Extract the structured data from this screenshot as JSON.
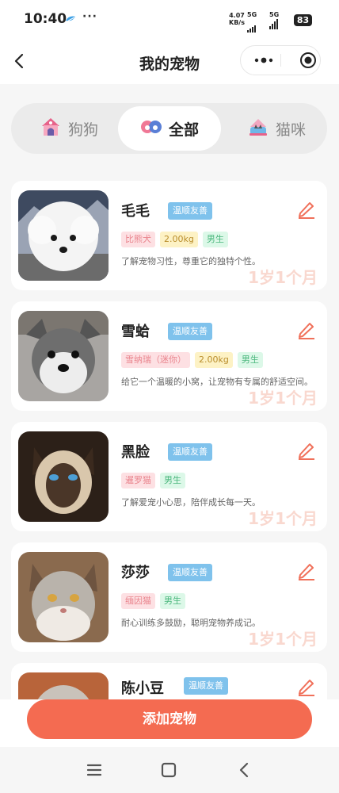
{
  "status_bar": {
    "time": "10:40",
    "more": "···",
    "speed_value": "4.07",
    "speed_unit": "KB/s",
    "network_1": "5G",
    "network_2": "5G",
    "battery": "83"
  },
  "nav": {
    "title": "我的宠物",
    "back_icon": "chevron-left-icon",
    "more_icon": "more-dots-icon",
    "close_icon": "target-close-icon"
  },
  "tabs": [
    {
      "label": "狗狗",
      "icon": "dog-house-icon",
      "active": false
    },
    {
      "label": "全部",
      "icon": "paws-icon",
      "active": true
    },
    {
      "label": "猫咪",
      "icon": "cat-bed-icon",
      "active": false
    }
  ],
  "pets": [
    {
      "name": "毛毛",
      "temper": "温顺友善",
      "tags": [
        {
          "text": "比熊犬",
          "type": "breed"
        },
        {
          "text": "2.00kg",
          "type": "weight"
        },
        {
          "text": "男生",
          "type": "sex"
        }
      ],
      "desc": "了解宠物习性，尊重它的独特个性。",
      "age": "1岁1个月",
      "photo": "bichon-photo"
    },
    {
      "name": "雪蛤",
      "temper": "温顺友善",
      "tags": [
        {
          "text": "雪纳瑞（迷你）",
          "type": "breed"
        },
        {
          "text": "2.00kg",
          "type": "weight"
        },
        {
          "text": "男生",
          "type": "sex"
        }
      ],
      "desc": "给它一个温暖的小窝，让宠物有专属的舒适空间。",
      "age": "1岁1个月",
      "photo": "schnauzer-photo"
    },
    {
      "name": "黑脸",
      "temper": "温顺友善",
      "tags": [
        {
          "text": "暹罗猫",
          "type": "breed"
        },
        {
          "text": "男生",
          "type": "sex"
        }
      ],
      "desc": "了解爱宠小心思，陪伴成长每一天。",
      "age": "1岁1个月",
      "photo": "siamese-photo"
    },
    {
      "name": "莎莎",
      "temper": "温顺友善",
      "tags": [
        {
          "text": "缅因猫",
          "type": "breed"
        },
        {
          "text": "男生",
          "type": "sex"
        }
      ],
      "desc": "耐心训练多鼓励，聪明宠物养成记。",
      "age": "1岁1个月",
      "photo": "maine-coon-photo"
    },
    {
      "name": "陈小豆",
      "temper": "温顺友善",
      "tags": [],
      "desc": "",
      "age": "",
      "photo": "cat-photo"
    }
  ],
  "add_button": "添加宠物",
  "system_nav": {
    "menu_icon": "menu-icon",
    "home_icon": "home-icon",
    "back_icon": "back-icon"
  },
  "colors": {
    "accent": "#f46b51",
    "temper_badge": "#7fc2ec",
    "age_text": "#f9d8cf"
  }
}
